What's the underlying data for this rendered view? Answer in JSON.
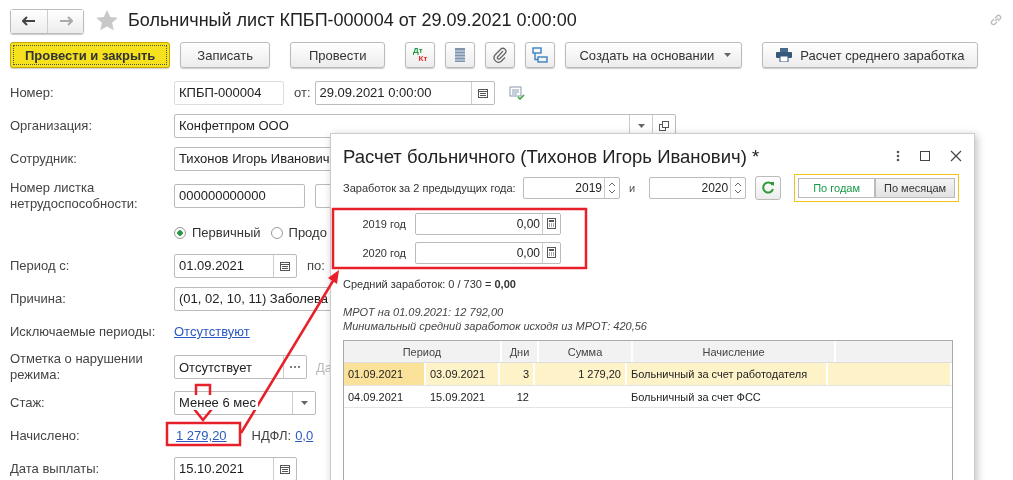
{
  "window": {
    "title": "Больничный лист КПБП-000004 от 29.09.2021 0:00:00",
    "favorite": false
  },
  "toolbar": [
    {
      "kind": "text",
      "label": "Провести и закрыть",
      "default": true
    },
    {
      "kind": "text",
      "label": "Записать",
      "default": false
    },
    {
      "kind": "text",
      "label": "Провести",
      "default": false
    },
    {
      "kind": "dtkt",
      "top": "Дт",
      "bottom": "Кт"
    },
    {
      "kind": "list"
    },
    {
      "kind": "clip"
    },
    {
      "kind": "structure"
    },
    {
      "kind": "dropdown",
      "label": "Создать на основании"
    },
    {
      "kind": "print",
      "label": "Расчет среднего заработка"
    }
  ],
  "form": {
    "number": {
      "label": "Номер:",
      "value": "КПБП-000004",
      "date_label": "от:",
      "date": "29.09.2021  0:00:00"
    },
    "organization": {
      "label": "Организация:",
      "value": "Конфетпром ООО"
    },
    "employee": {
      "label": "Сотрудник:",
      "value": "Тихонов Игорь Иванович"
    },
    "sick_note": {
      "label": "Номер листка нетрудоспособности:",
      "value": "000000000000"
    },
    "type_options": [
      {
        "label": "Первичный",
        "selected": true
      },
      {
        "label": "Продо",
        "selected": false
      }
    ],
    "period": {
      "label": "Период с:",
      "from": "01.09.2021",
      "to_label": "по:"
    },
    "reason": {
      "label": "Причина:",
      "value": "(01, 02, 10, 11) Заболева"
    },
    "excluded": {
      "label": "Исключаемые периоды:",
      "link": "Отсутствуют"
    },
    "violation": {
      "label": "Отметка о нарушении режима:",
      "value": "Отсутствует",
      "extra": "Да"
    },
    "experience": {
      "label": "Стаж:",
      "value": "Менее 6 мес"
    },
    "accrued": {
      "label": "Начислено:",
      "link": "1 279,20",
      "tax_label": "НДФЛ:",
      "tax_link": "0,0"
    },
    "pay_date": {
      "label": "Дата выплаты:",
      "value": "15.10.2021"
    }
  },
  "dialog": {
    "title": "Расчет больничного (Тихонов Игорь Иванович) *",
    "earnings_label": "Заработок за 2 предыдущих года:",
    "year_from": "2019",
    "and": "и",
    "year_to": "2020",
    "modes": [
      {
        "label": "По годам",
        "selected": true
      },
      {
        "label": "По месяцам",
        "selected": false
      }
    ],
    "years": [
      {
        "label": "2019 год",
        "value": "0,00"
      },
      {
        "label": "2020 год",
        "value": "0,00"
      }
    ],
    "average": "Средний заработок: 0 / 730 = **0,00**",
    "mrot": "МРОТ на 01.09.2021: 12 792,00",
    "min_average": "Минимальный средний заработок исходя из МРОТ: 420,56",
    "table": {
      "columns": [
        "Период",
        "Дни",
        "Сумма",
        "Начисление"
      ],
      "rows": [
        {
          "from": "01.09.2021",
          "to": "03.09.2021",
          "days": "3",
          "amount": "1 279,20",
          "accrual": "Больничный за счет работодателя",
          "selected": true
        },
        {
          "from": "04.09.2021",
          "to": "15.09.2021",
          "days": "12",
          "accrual": "Больничный за счет ФСС",
          "selected": false
        }
      ]
    }
  }
}
